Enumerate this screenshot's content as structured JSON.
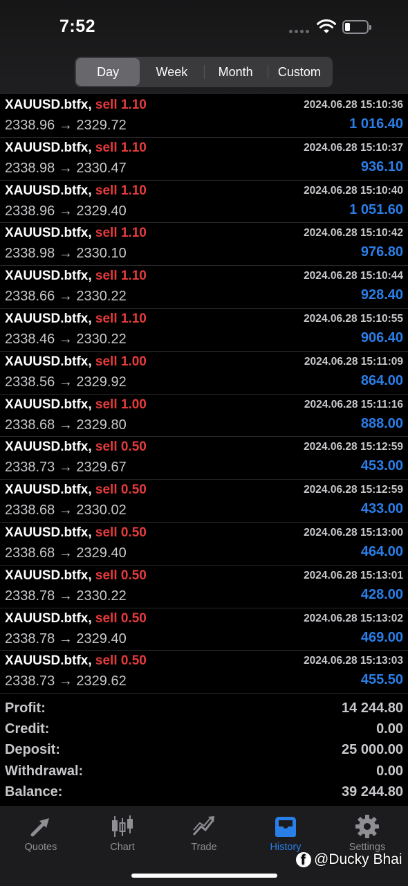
{
  "status_bar": {
    "time": "7:52"
  },
  "segmented": {
    "tabs": [
      {
        "label": "Day",
        "active": true
      },
      {
        "label": "Week",
        "active": false
      },
      {
        "label": "Month",
        "active": false
      },
      {
        "label": "Custom",
        "active": false
      }
    ]
  },
  "trades": [
    {
      "symbol": "XAUUSD.btfx,",
      "side": "sell 1.10",
      "time": "2024.06.28 15:10:36",
      "open": "2338.96",
      "close": "2329.72",
      "profit": "1 016.40"
    },
    {
      "symbol": "XAUUSD.btfx,",
      "side": "sell 1.10",
      "time": "2024.06.28 15:10:37",
      "open": "2338.98",
      "close": "2330.47",
      "profit": "936.10"
    },
    {
      "symbol": "XAUUSD.btfx,",
      "side": "sell 1.10",
      "time": "2024.06.28 15:10:40",
      "open": "2338.96",
      "close": "2329.40",
      "profit": "1 051.60"
    },
    {
      "symbol": "XAUUSD.btfx,",
      "side": "sell 1.10",
      "time": "2024.06.28 15:10:42",
      "open": "2338.98",
      "close": "2330.10",
      "profit": "976.80"
    },
    {
      "symbol": "XAUUSD.btfx,",
      "side": "sell 1.10",
      "time": "2024.06.28 15:10:44",
      "open": "2338.66",
      "close": "2330.22",
      "profit": "928.40"
    },
    {
      "symbol": "XAUUSD.btfx,",
      "side": "sell 1.10",
      "time": "2024.06.28 15:10:55",
      "open": "2338.46",
      "close": "2330.22",
      "profit": "906.40"
    },
    {
      "symbol": "XAUUSD.btfx,",
      "side": "sell 1.00",
      "time": "2024.06.28 15:11:09",
      "open": "2338.56",
      "close": "2329.92",
      "profit": "864.00"
    },
    {
      "symbol": "XAUUSD.btfx,",
      "side": "sell 1.00",
      "time": "2024.06.28 15:11:16",
      "open": "2338.68",
      "close": "2329.80",
      "profit": "888.00"
    },
    {
      "symbol": "XAUUSD.btfx,",
      "side": "sell 0.50",
      "time": "2024.06.28 15:12:59",
      "open": "2338.73",
      "close": "2329.67",
      "profit": "453.00"
    },
    {
      "symbol": "XAUUSD.btfx,",
      "side": "sell 0.50",
      "time": "2024.06.28 15:12:59",
      "open": "2338.68",
      "close": "2330.02",
      "profit": "433.00"
    },
    {
      "symbol": "XAUUSD.btfx,",
      "side": "sell 0.50",
      "time": "2024.06.28 15:13:00",
      "open": "2338.68",
      "close": "2329.40",
      "profit": "464.00"
    },
    {
      "symbol": "XAUUSD.btfx,",
      "side": "sell 0.50",
      "time": "2024.06.28 15:13:01",
      "open": "2338.78",
      "close": "2330.22",
      "profit": "428.00"
    },
    {
      "symbol": "XAUUSD.btfx,",
      "side": "sell 0.50",
      "time": "2024.06.28 15:13:02",
      "open": "2338.78",
      "close": "2329.40",
      "profit": "469.00"
    },
    {
      "symbol": "XAUUSD.btfx,",
      "side": "sell 0.50",
      "time": "2024.06.28 15:13:03",
      "open": "2338.73",
      "close": "2329.62",
      "profit": "455.50"
    }
  ],
  "summary": [
    {
      "label": "Profit:",
      "value": "14 244.80"
    },
    {
      "label": "Credit:",
      "value": "0.00"
    },
    {
      "label": "Deposit:",
      "value": "25 000.00"
    },
    {
      "label": "Withdrawal:",
      "value": "0.00"
    },
    {
      "label": "Balance:",
      "value": "39 244.80"
    }
  ],
  "tabbar": {
    "items": [
      {
        "label": "Quotes",
        "icon": "quotes-icon",
        "active": false
      },
      {
        "label": "Chart",
        "icon": "chart-icon",
        "active": false
      },
      {
        "label": "Trade",
        "icon": "trade-icon",
        "active": false
      },
      {
        "label": "History",
        "icon": "history-icon",
        "active": true
      },
      {
        "label": "Settings",
        "icon": "settings-icon",
        "active": false
      }
    ]
  },
  "watermark": {
    "text": "@Ducky Bhai",
    "icon": "facebook-icon"
  },
  "colors": {
    "sell": "#e53b3b",
    "profit": "#2a7ee8",
    "active_tab": "#2a7ee8"
  }
}
